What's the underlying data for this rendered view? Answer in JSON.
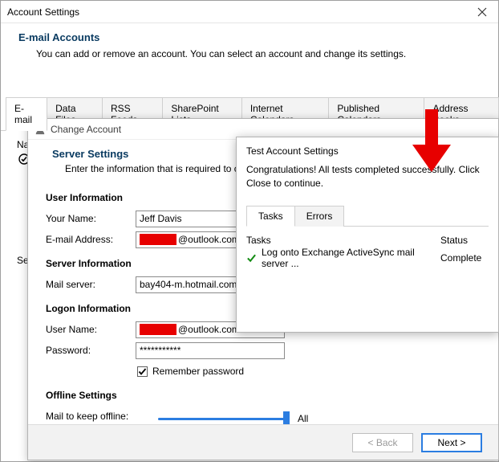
{
  "accountSettings": {
    "title": "Account Settings",
    "h1": "E-mail Accounts",
    "subtitle": "You can add or remove an account. You can select an account and change its settings.",
    "tabs": [
      "E-mail",
      "Data Files",
      "RSS Feeds",
      "SharePoint Lists",
      "Internet Calendars",
      "Published Calendars",
      "Address Books"
    ],
    "selectedTab": 0,
    "listHeader": "Na",
    "listHeaderFull": "Name",
    "selectAccountLabel": "Sele"
  },
  "changeAccount": {
    "title": "Change Account",
    "h1": "Server Settings",
    "h1_sub": "Enter the information that is required to co",
    "sections": {
      "user_info": "User Information",
      "server_info": "Server Information",
      "logon_info": "Logon Information",
      "offline": "Offline Settings"
    },
    "labels": {
      "your_name": "Your Name:",
      "email": "E-mail Address:",
      "mail_server": "Mail server:",
      "user_name": "User Name:",
      "password": "Password:",
      "remember": "Remember password",
      "mail_offline": "Mail to keep offline:"
    },
    "values": {
      "your_name": "Jeff Davis",
      "email_suffix": "@outlook.com",
      "mail_server": "bay404-m.hotmail.com",
      "user_name_suffix": "@outlook.com",
      "password_masked": "***********",
      "remember_checked": true,
      "slider_label": "All",
      "slider_percent": 100
    },
    "buttons": {
      "back": "< Back",
      "next": "Next >"
    }
  },
  "testAccountSettings": {
    "title": "Test Account Settings",
    "message": "Congratulations! All tests completed successfully. Click Close to continue.",
    "tabs": [
      "Tasks",
      "Errors"
    ],
    "selectedTab": 0,
    "columns": {
      "tasks": "Tasks",
      "status": "Status"
    },
    "rows": [
      {
        "task": "Log onto Exchange ActiveSync mail server ...",
        "status": "Complete",
        "ok": true
      }
    ]
  }
}
